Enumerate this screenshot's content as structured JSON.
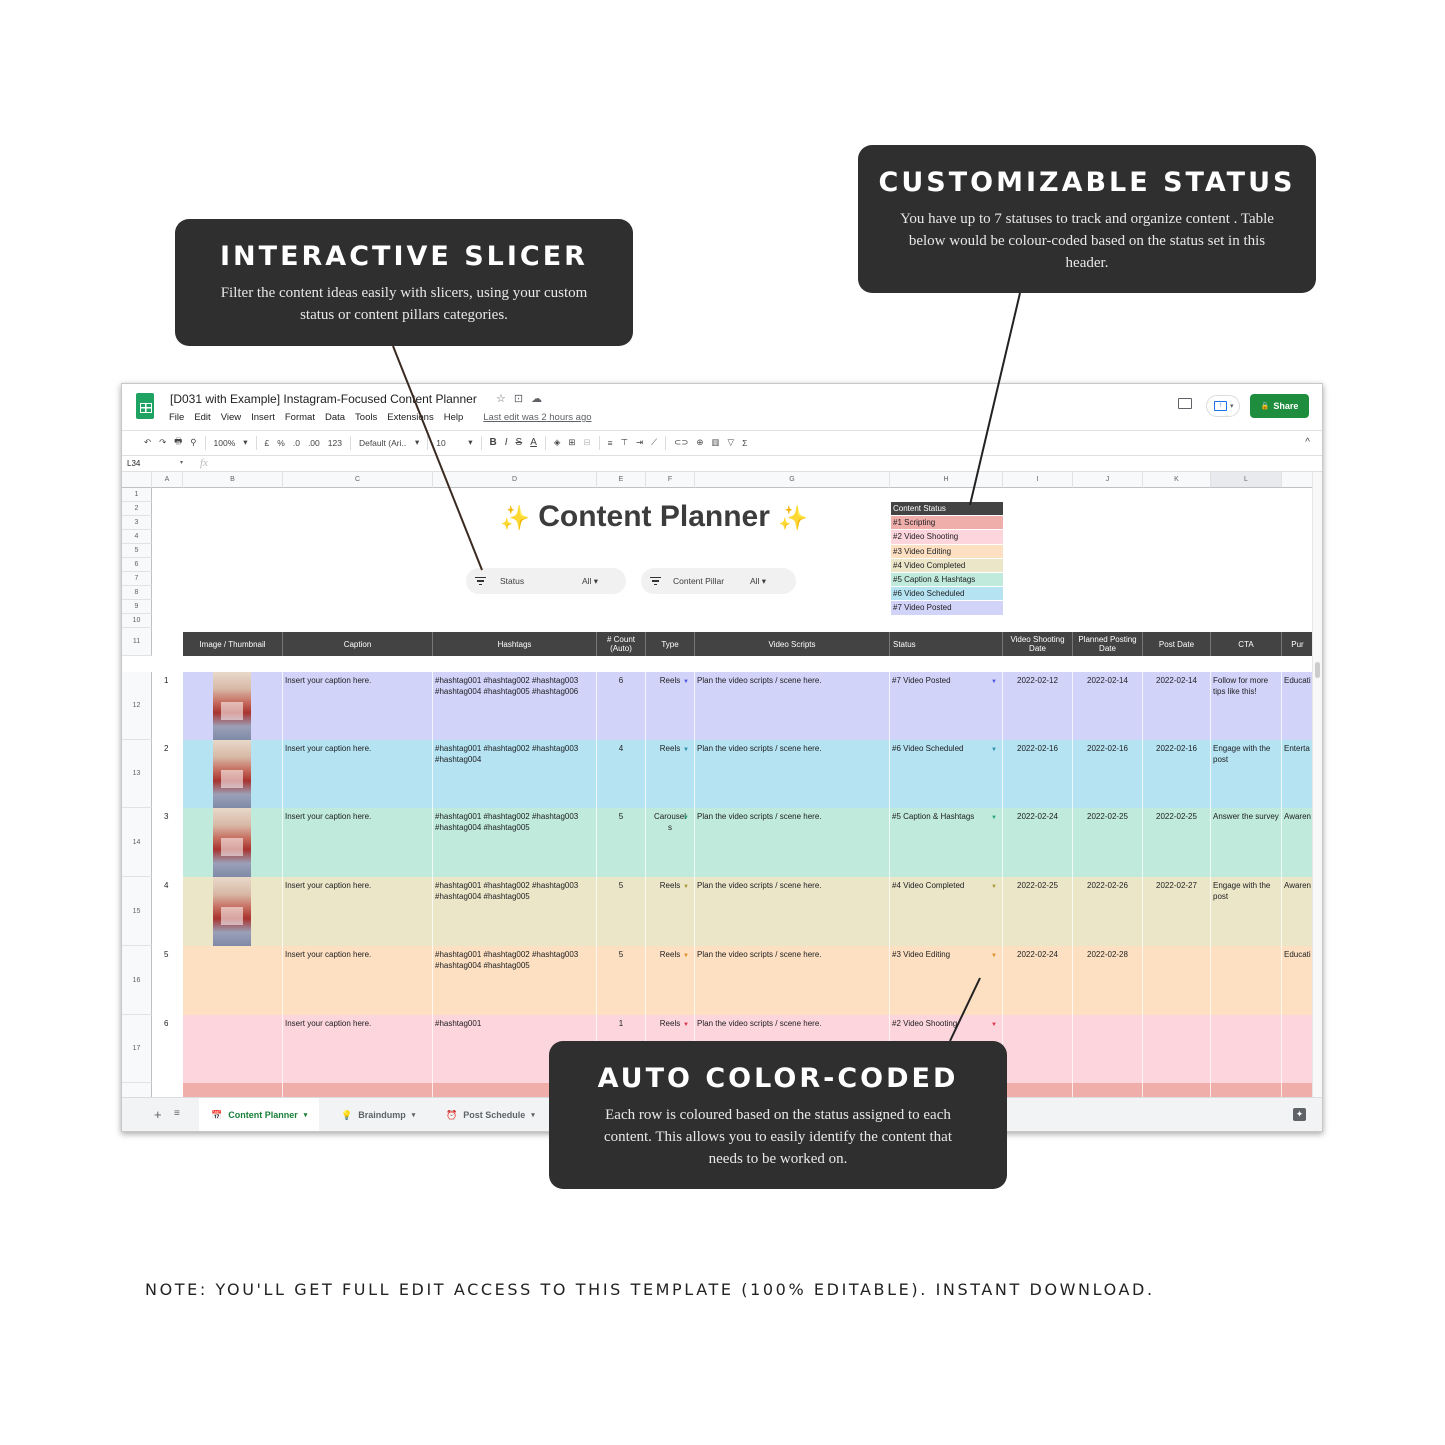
{
  "callouts": {
    "slicer": {
      "title": "INTERACTIVE SLICER",
      "body": "Filter the content ideas easily with slicers, using your custom status or content pillars categories."
    },
    "status": {
      "title": "CUSTOMIZABLE STATUS",
      "body": "You have up to 7 statuses to track and organize content . Table below would be colour-coded based on the status set in this header."
    },
    "autocolor": {
      "title": "AUTO COLOR-CODED",
      "body": "Each row is coloured based on the status assigned to each content. This allows you to easily identify the content that needs to be worked on."
    }
  },
  "note": "NOTE: YOU'LL GET FULL EDIT ACCESS TO THIS TEMPLATE (100% EDITABLE). INSTANT DOWNLOAD.",
  "app": {
    "doc_title": "[D031 with Example] Instagram-Focused Content Planner",
    "title_icons": [
      "☆",
      "⊡",
      "☁"
    ],
    "menu": [
      "File",
      "Edit",
      "View",
      "Insert",
      "Format",
      "Data",
      "Tools",
      "Extensions",
      "Help"
    ],
    "last_edit": "Last edit was 2 hours ago",
    "share_label": "Share",
    "share_icon": "🔒"
  },
  "toolbar": {
    "undo": "↶",
    "redo": "↷",
    "print": "🖶",
    "paint_format": "⚲",
    "zoom": "100%",
    "currency": "£",
    "percent": "%",
    "dec_less": ".0",
    "dec_more": ".00",
    "more_formats": "123",
    "font": "Default (Ari...",
    "font_size": "10",
    "bold": "B",
    "italic": "I",
    "strike": "S",
    "text_color": "A",
    "fill": "◈",
    "borders": "⊞",
    "merge": "⊟",
    "halign": "≡",
    "valign": "⊤",
    "wrap": "⇥",
    "rotate": "⟋",
    "link": "⊂⊃",
    "comment": "⊕",
    "chart": "▥",
    "filter": "▽",
    "functions": "Σ",
    "collapse": "^"
  },
  "formula_bar": {
    "cell_ref": "L34",
    "fx": "fx"
  },
  "columns": [
    "A",
    "B",
    "C",
    "D",
    "E",
    "F",
    "G",
    "H",
    "I",
    "J",
    "K",
    "L"
  ],
  "rows_top": [
    "1",
    "2",
    "3",
    "4",
    "5",
    "6",
    "7",
    "8",
    "9",
    "10",
    "11"
  ],
  "planner_title": {
    "sparkle": "✨",
    "text": "Content Planner"
  },
  "slicers": [
    {
      "label": "Status",
      "value": "All ▾"
    },
    {
      "label": "Content Pillar",
      "value": "All ▾"
    }
  ],
  "status_legend": {
    "header": "Content Status",
    "items": [
      {
        "label": "#1 Scripting",
        "color": "#f0aeab"
      },
      {
        "label": "#2 Video Shooting",
        "color": "#fdd5dd"
      },
      {
        "label": "#3 Video Editing",
        "color": "#fde0c1"
      },
      {
        "label": "#4 Video Completed",
        "color": "#ece6c8"
      },
      {
        "label": "#5 Caption & Hashtags",
        "color": "#c0eadc"
      },
      {
        "label": "#6 Video Scheduled",
        "color": "#b5e3f2"
      },
      {
        "label": "#7 Video Posted",
        "color": "#d2d3f8"
      }
    ]
  },
  "table": {
    "headers": [
      "Image / Thumbnail",
      "Caption",
      "Hashtags",
      "# Count (Auto)",
      "Type",
      "Video Scripts",
      "Status",
      "Video Shooting Date",
      "Planned Posting Date",
      "Post Date",
      "CTA",
      "Pur"
    ],
    "rows": [
      {
        "sheet_row": "12",
        "num": "1",
        "thumb": true,
        "caption": "Insert your caption here.",
        "hashtags": "#hashtag001 #hashtag002 #hashtag003 #hashtag004 #hashtag005 #hashtag006",
        "count": "6",
        "type": "Reels",
        "script": "Plan the video scripts / scene here.",
        "status": "#7 Video Posted",
        "shoot": "2022-02-12",
        "planned": "2022-02-14",
        "post": "2022-02-14",
        "cta": "Follow for more tips like this!",
        "purpose": "Educati",
        "color": "#d2d3f8",
        "dd_color": "#4a5ae0"
      },
      {
        "sheet_row": "13",
        "num": "2",
        "thumb": true,
        "caption": "Insert your caption here.",
        "hashtags": "#hashtag001 #hashtag002 #hashtag003 #hashtag004",
        "count": "4",
        "type": "Reels",
        "script": "Plan the video scripts / scene here.",
        "status": "#6 Video Scheduled",
        "shoot": "2022-02-16",
        "planned": "2022-02-16",
        "post": "2022-02-16",
        "cta": "Engage with the post",
        "purpose": "Enterta",
        "color": "#b5e3f2",
        "dd_color": "#2a8cb0"
      },
      {
        "sheet_row": "14",
        "num": "3",
        "thumb": true,
        "caption": "Insert your caption here.",
        "hashtags": "#hashtag001 #hashtag002 #hashtag003 #hashtag004 #hashtag005",
        "count": "5",
        "type": "Carousels",
        "script": "Plan the video scripts / scene here.",
        "status": "#5 Caption & Hashtags",
        "shoot": "2022-02-24",
        "planned": "2022-02-25",
        "post": "2022-02-25",
        "cta": "Answer the survey",
        "purpose": "Awaren",
        "color": "#c0eadc",
        "dd_color": "#2aa37a"
      },
      {
        "sheet_row": "15",
        "num": "4",
        "thumb": true,
        "caption": "Insert your caption here.",
        "hashtags": "#hashtag001 #hashtag002 #hashtag003 #hashtag004 #hashtag005",
        "count": "5",
        "type": "Reels",
        "script": "Plan the video scripts / scene here.",
        "status": "#4 Video Completed",
        "shoot": "2022-02-25",
        "planned": "2022-02-26",
        "post": "2022-02-27",
        "cta": "Engage with the post",
        "purpose": "Awaren",
        "color": "#ece6c8",
        "dd_color": "#a89a3a"
      },
      {
        "sheet_row": "16",
        "num": "5",
        "thumb": false,
        "caption": "Insert your caption here.",
        "hashtags": "#hashtag001 #hashtag002 #hashtag003 #hashtag004 #hashtag005",
        "count": "5",
        "type": "Reels",
        "script": "Plan the video scripts / scene here.",
        "status": "#3 Video Editing",
        "shoot": "2022-02-24",
        "planned": "2022-02-28",
        "post": "",
        "cta": "",
        "purpose": "Educati",
        "color": "#fde0c1",
        "dd_color": "#e08a1e"
      },
      {
        "sheet_row": "17",
        "num": "6",
        "thumb": false,
        "caption": "Insert your caption here.",
        "hashtags": "#hashtag001",
        "count": "1",
        "type": "Reels",
        "script": "Plan the video scripts / scene here.",
        "status": "#2 Video Shooting",
        "shoot": "",
        "planned": "",
        "post": "",
        "cta": "",
        "purpose": "",
        "color": "#fdd5dd",
        "dd_color": "#e0304a"
      },
      {
        "sheet_row": "",
        "num": "",
        "thumb": false,
        "caption": "",
        "hashtags": "",
        "count": "",
        "type": "",
        "script": "",
        "status": "",
        "shoot": "",
        "planned": "",
        "post": "",
        "cta": "",
        "purpose": "",
        "color": "#f0aeab",
        "dd_color": ""
      }
    ]
  },
  "sheets": {
    "add": "+",
    "all": "≡",
    "tabs": [
      {
        "icon": "📅",
        "label": "Content Planner",
        "active": true
      },
      {
        "icon": "💡",
        "label": "Braindump",
        "active": false
      },
      {
        "icon": "⏰",
        "label": "Post Schedule",
        "active": false
      }
    ],
    "dropdown": "▾",
    "explore": "✦"
  }
}
